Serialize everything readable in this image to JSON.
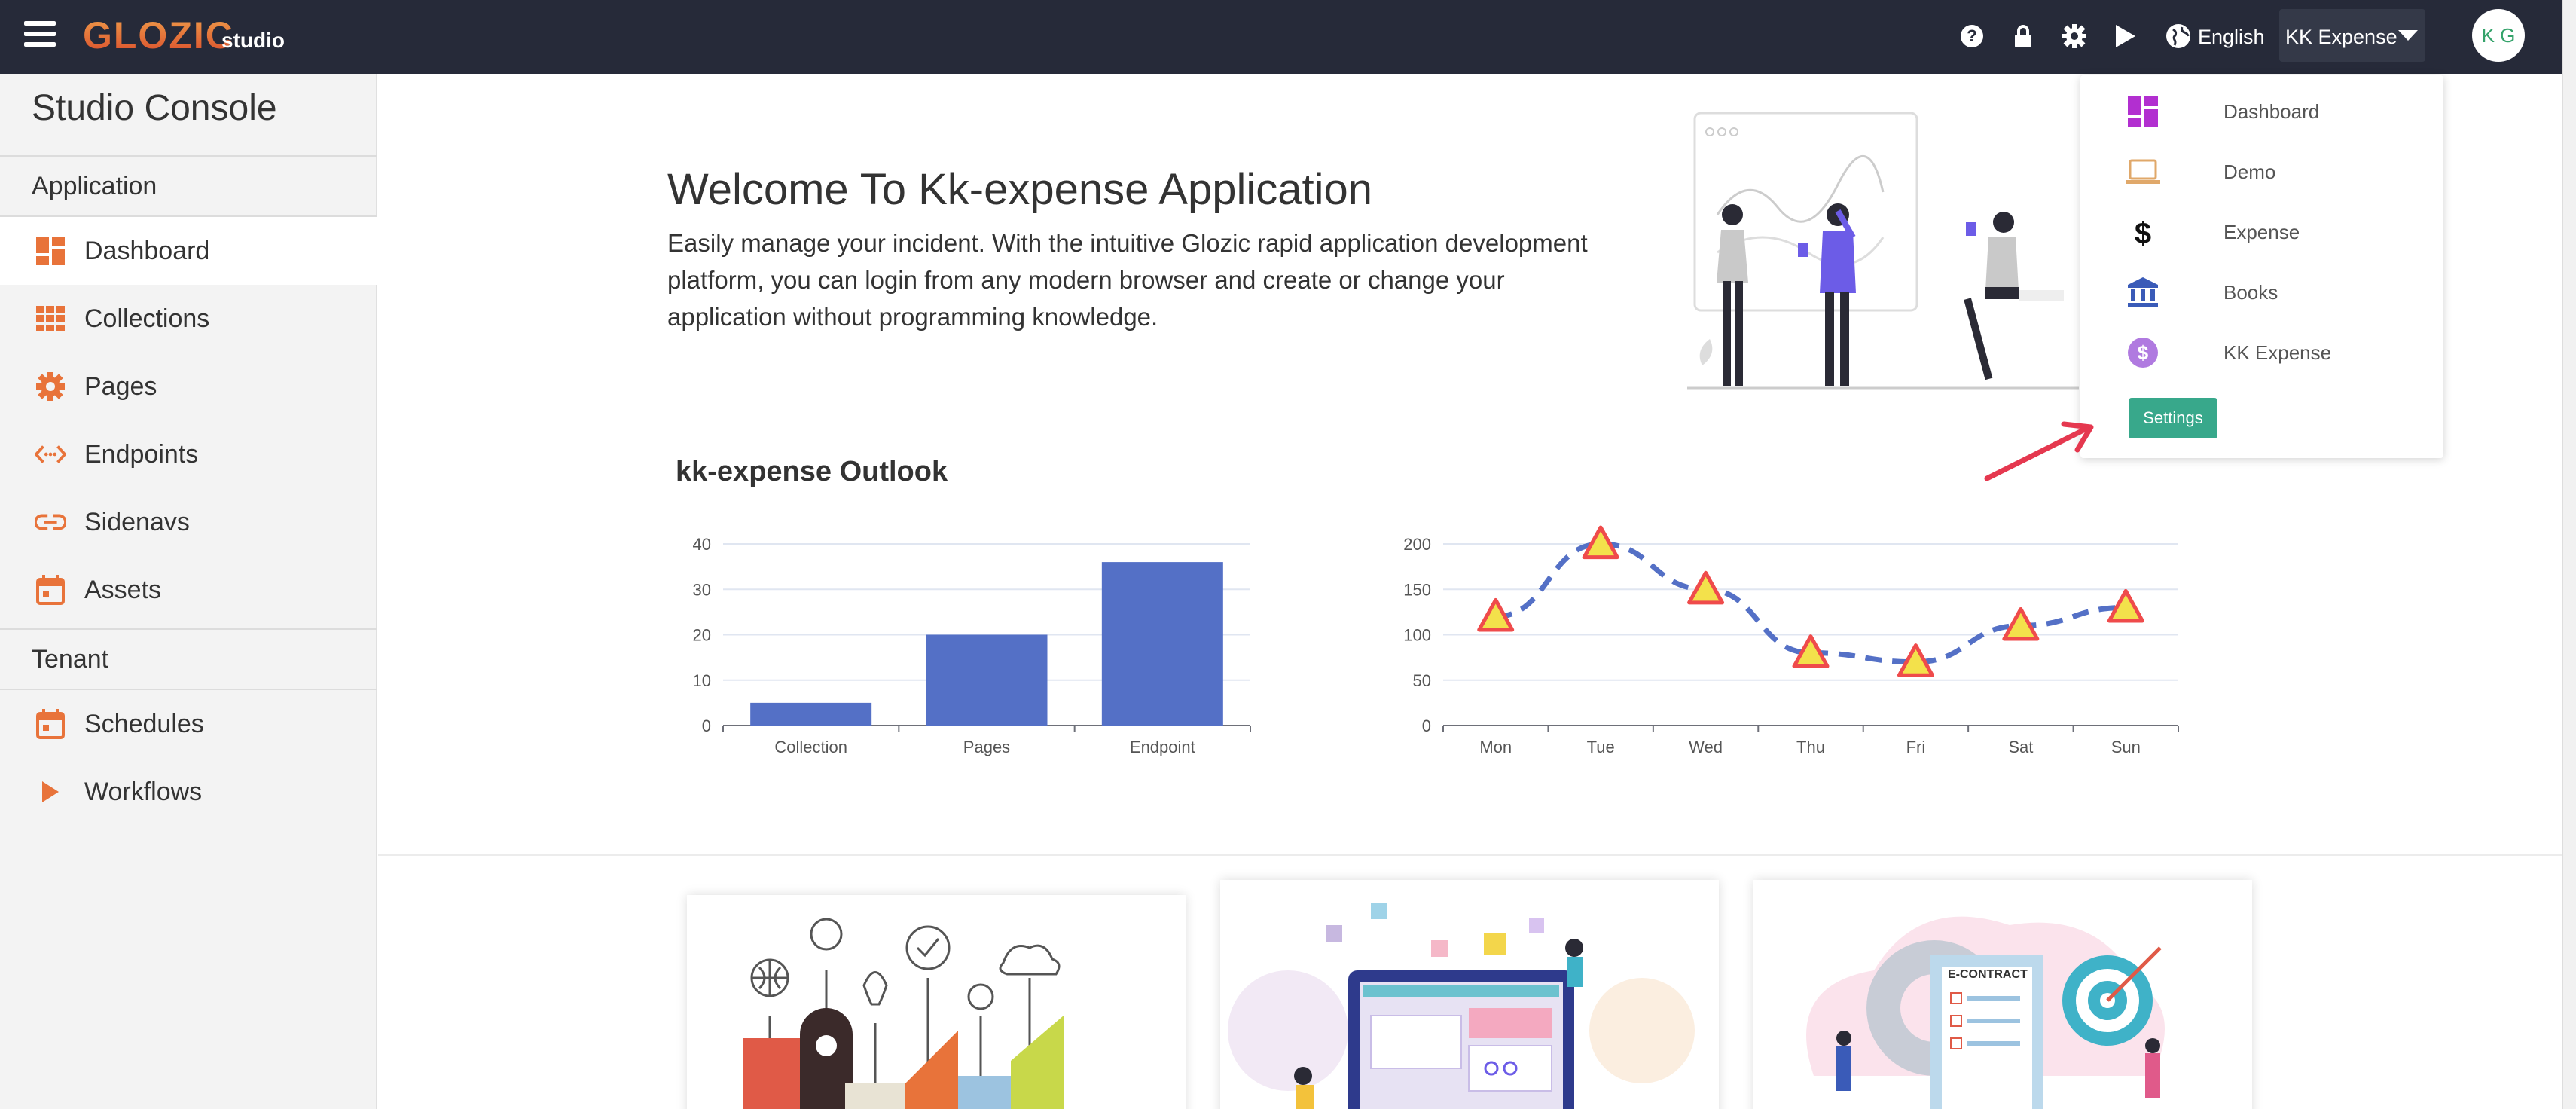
{
  "topbar": {
    "logo": "GLOZIC",
    "logo_sub": "studio",
    "language": "English",
    "current_app": "KK Expense",
    "avatar_initials": "K G"
  },
  "sidebar": {
    "title": "Studio Console",
    "sections": [
      {
        "label": "Application"
      },
      {
        "label": "Tenant"
      }
    ],
    "items": [
      {
        "label": "Dashboard",
        "icon": "dashboard-icon"
      },
      {
        "label": "Collections",
        "icon": "grid-icon"
      },
      {
        "label": "Pages",
        "icon": "gear-icon"
      },
      {
        "label": "Endpoints",
        "icon": "code-icon"
      },
      {
        "label": "Sidenavs",
        "icon": "link-icon"
      },
      {
        "label": "Assets",
        "icon": "calendar-icon"
      },
      {
        "label": "Schedules",
        "icon": "calendar-icon"
      },
      {
        "label": "Workflows",
        "icon": "play-icon"
      }
    ]
  },
  "main": {
    "welcome_title": "Welcome To Kk-expense Application",
    "welcome_desc": "Easily manage your incident. With the intuitive Glozic rapid application development platform, you can login from any modern browser and create or change your application without programming knowledge.",
    "outlook_title": "kk-expense Outlook"
  },
  "dropdown": {
    "items": [
      {
        "label": "Dashboard",
        "icon": "dashboard-icon"
      },
      {
        "label": "Demo",
        "icon": "laptop-icon"
      },
      {
        "label": "Expense",
        "icon": "dollar-icon"
      },
      {
        "label": "Books",
        "icon": "bank-icon"
      },
      {
        "label": "KK Expense",
        "icon": "dollar-circle-icon"
      }
    ],
    "settings_label": "Settings"
  },
  "colors": {
    "topbar": "#262a39",
    "accent_orange": "#e8733a",
    "bar_blue": "#5470c6",
    "settings_green": "#38a88b",
    "arrow_red": "#e5384f"
  },
  "chart_data": [
    {
      "type": "bar",
      "categories": [
        "Collection",
        "Pages",
        "Endpoint"
      ],
      "values": [
        5,
        20,
        36
      ],
      "title": "",
      "ylim": [
        0,
        40
      ],
      "yticks": [
        0,
        10,
        20,
        30,
        40
      ]
    },
    {
      "type": "line",
      "categories": [
        "Mon",
        "Tue",
        "Wed",
        "Thu",
        "Fri",
        "Sat",
        "Sun"
      ],
      "values": [
        120,
        200,
        150,
        80,
        70,
        110,
        130
      ],
      "title": "",
      "ylim": [
        0,
        200
      ],
      "yticks": [
        0,
        50,
        100,
        150,
        200
      ],
      "line_style": "dashed",
      "marker": "triangle"
    }
  ]
}
